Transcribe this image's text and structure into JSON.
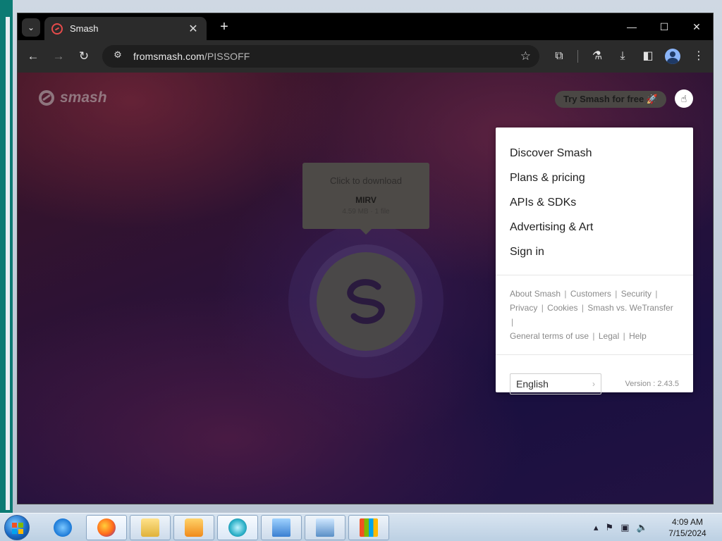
{
  "browser": {
    "tab_title": "Smash",
    "url_host": "fromsmash.com",
    "url_path": "/PISSOFF"
  },
  "page": {
    "logo_text": "smash",
    "try_button": "Try Smash for free 🚀",
    "tooltip": {
      "hint": "Click to download",
      "file_name": "MIRV",
      "file_info": "4.59 MB · 1 file"
    },
    "menu": {
      "items": [
        {
          "label": "Discover Smash"
        },
        {
          "label": "Plans & pricing"
        },
        {
          "label": "APIs & SDKs"
        },
        {
          "label": "Advertising & Art"
        },
        {
          "label": "Sign in"
        }
      ],
      "links": {
        "about": "About Smash",
        "customers": "Customers",
        "security": "Security",
        "privacy": "Privacy",
        "cookies": "Cookies",
        "vs": "Smash vs. WeTransfer",
        "terms": "General terms of use",
        "legal": "Legal",
        "help": "Help",
        "separator": "|"
      },
      "language": "English",
      "version": "Version : 2.43.5"
    }
  },
  "taskbar": {
    "time": "4:09 AM",
    "date": "7/15/2024"
  },
  "colors": {
    "brand": "#e74b4b",
    "menu_bg": "#ffffff",
    "chrome_bg": "#2b2b2b"
  }
}
